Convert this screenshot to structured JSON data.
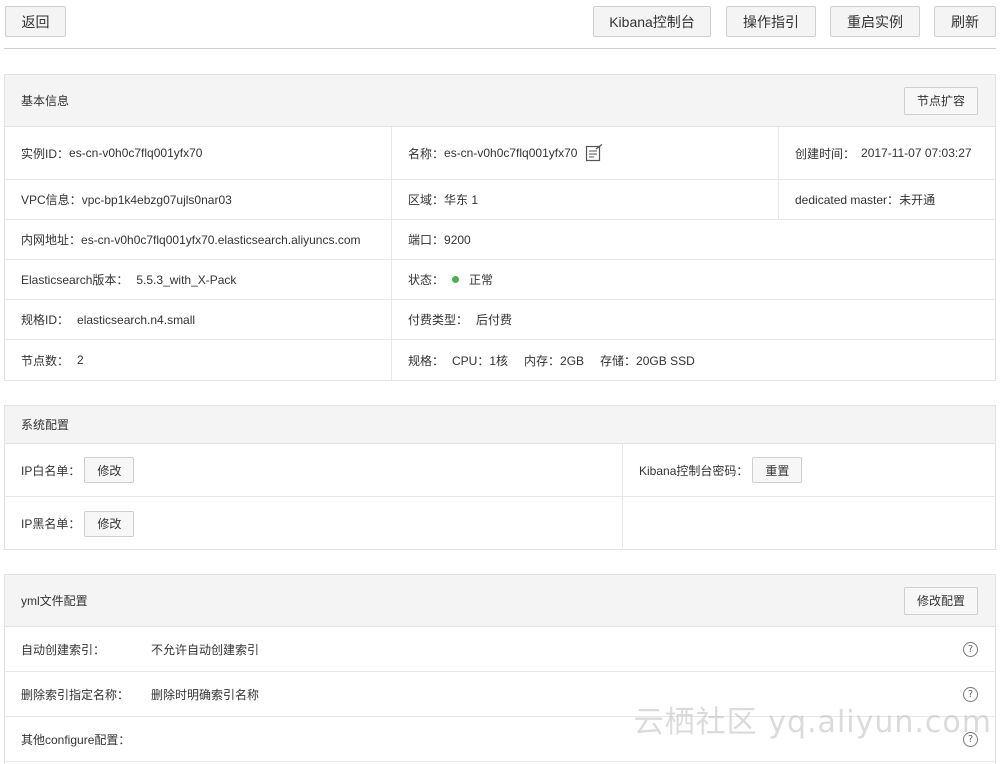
{
  "toolbar": {
    "back": "返回",
    "kibana": "Kibana控制台",
    "guide": "操作指引",
    "restart": "重启实例",
    "refresh": "刷新"
  },
  "basic": {
    "title": "基本信息",
    "scale_btn": "节点扩容",
    "rows": [
      [
        {
          "label": "实例ID：",
          "value": "es-cn-v0h0c7flq001yfx70"
        },
        {
          "label": "名称：",
          "value": "es-cn-v0h0c7flq001yfx70"
        },
        {
          "label": "创建时间：",
          "value": "2017-11-07 07:03:27"
        }
      ],
      [
        {
          "label": "VPC信息：",
          "value": "vpc-bp1k4ebzg07ujls0nar03"
        },
        {
          "label": "区域：",
          "value": "华东 1"
        },
        {
          "label": "dedicated master：",
          "value": "未开通"
        }
      ],
      [
        {
          "label": "内网地址：",
          "value": "es-cn-v0h0c7flq001yfx70.elasticsearch.aliyuncs.com"
        },
        {
          "label": "端口：",
          "value": "9200"
        }
      ],
      [
        {
          "label": "Elasticsearch版本：",
          "value": "5.5.3_with_X-Pack"
        },
        {
          "label": "状态：",
          "value": "正常"
        }
      ],
      [
        {
          "label": "规格ID：",
          "value": "elasticsearch.n4.small"
        },
        {
          "label": "付费类型：",
          "value": "后付费"
        }
      ],
      [
        {
          "label": "节点数：",
          "value": "2"
        },
        {
          "label": "规格：",
          "cpu": "CPU：1核",
          "mem": "内存：2GB",
          "disk": "存储：20GB SSD"
        }
      ]
    ],
    "status_color": "#4caf50"
  },
  "system": {
    "title": "系统配置",
    "ip_white_label": "IP白名单：",
    "ip_white_btn": "修改",
    "kibana_pwd_label": "Kibana控制台密码：",
    "kibana_pwd_btn": "重置",
    "ip_black_label": "IP黑名单：",
    "ip_black_btn": "修改"
  },
  "yml": {
    "title": "yml文件配置",
    "edit_btn": "修改配置",
    "rows": [
      {
        "label": "自动创建索引：",
        "value": "不允许自动创建索引",
        "help": "?"
      },
      {
        "label": "删除索引指定名称：",
        "value": "删除时明确索引名称",
        "help": "?"
      },
      {
        "label": "其他configure配置：",
        "value": "",
        "help": "?"
      }
    ]
  },
  "watermark": "云栖社区 yq.aliyun.com"
}
